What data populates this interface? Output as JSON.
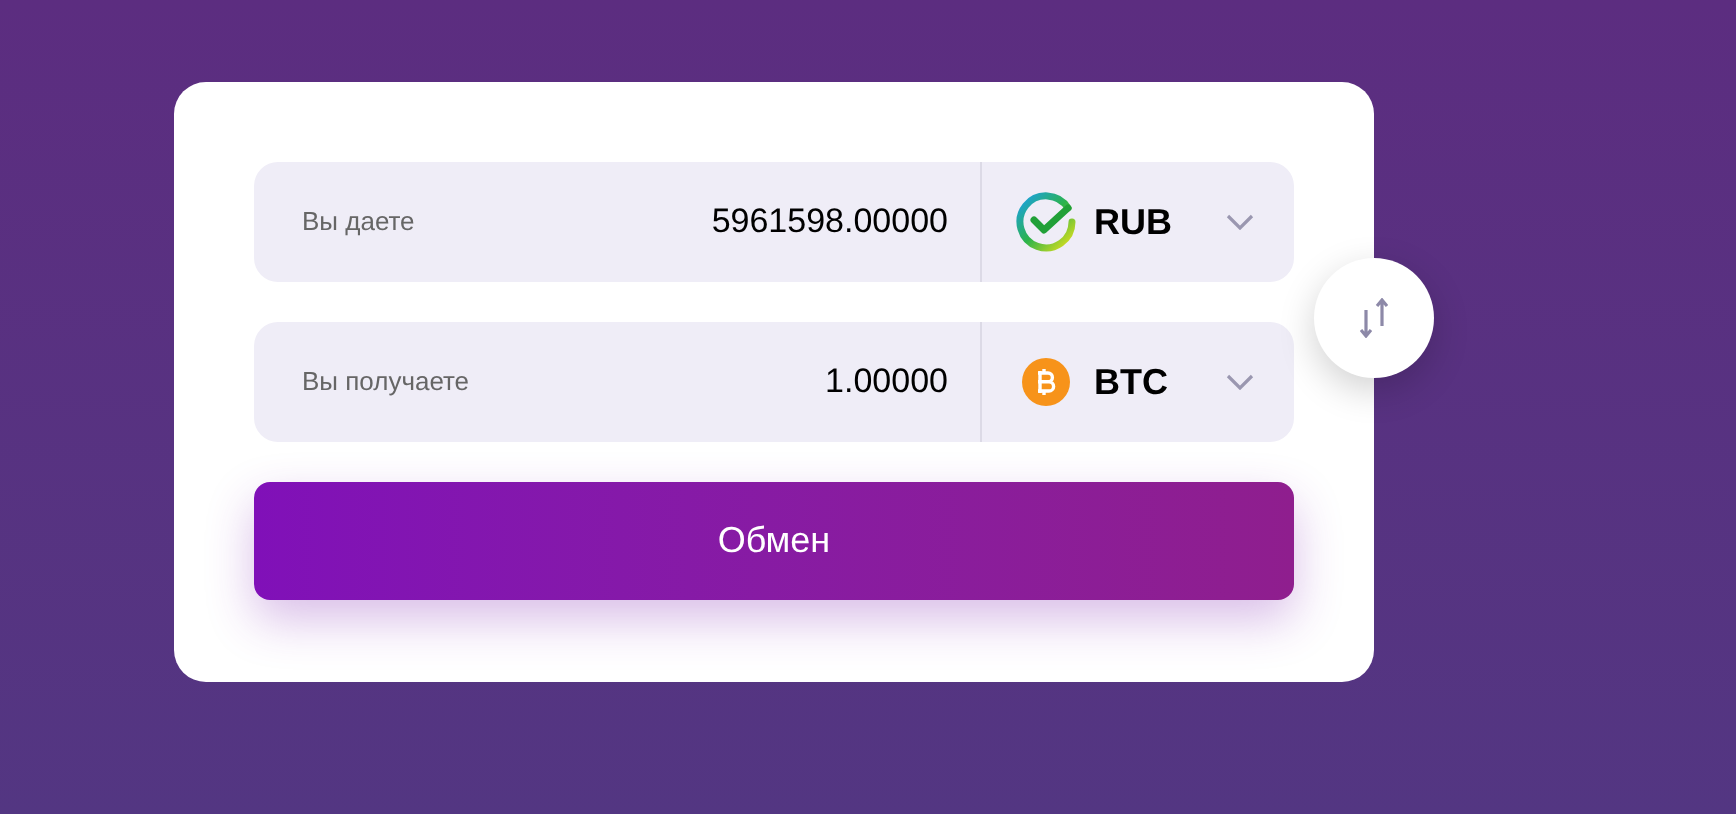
{
  "exchange": {
    "rows": [
      {
        "label": "Вы даете",
        "value": "5961598.00000",
        "currency": "RUB",
        "kind": "sber"
      },
      {
        "label": "Вы получаете",
        "value": "1.00000",
        "currency": "BTC",
        "kind": "btc"
      }
    ],
    "submit": "Обмен"
  }
}
